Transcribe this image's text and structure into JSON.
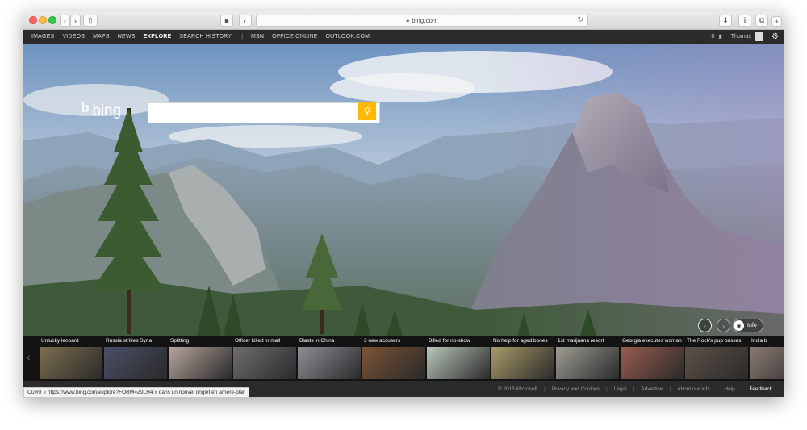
{
  "browser": {
    "url": "bing.com"
  },
  "nav": {
    "items": [
      "IMAGES",
      "VIDEOS",
      "MAPS",
      "NEWS",
      "EXPLORE",
      "SEARCH HISTORY"
    ],
    "separator": "|",
    "links": [
      "MSN",
      "OFFICE ONLINE",
      "OUTLOOK.COM"
    ],
    "rewards_count": "0",
    "user_name": "Thomas"
  },
  "logo": {
    "text": "bing"
  },
  "search": {
    "placeholder": ""
  },
  "hero_controls": {
    "info_label": "Info"
  },
  "news": [
    {
      "title": "Unlucky leopard",
      "color": "#7d6f4f"
    },
    {
      "title": "Russia strikes Syria",
      "color": "#4a4f66"
    },
    {
      "title": "Splitting",
      "color": "#b7a59d"
    },
    {
      "title": "Officer killed in mall",
      "color": "#6e6e6e"
    },
    {
      "title": "Blasts in China",
      "color": "#8c8f95"
    },
    {
      "title": "3 new accusers",
      "color": "#7c5335"
    },
    {
      "title": "Billed for no-show",
      "color": "#b9c6b9"
    },
    {
      "title": "No help for aged bones",
      "color": "#a89a6a"
    },
    {
      "title": "1st marijuana resort",
      "color": "#9e9c94"
    },
    {
      "title": "Georgia executes woman",
      "color": "#9a5c4e"
    },
    {
      "title": "The Rock's pup passes",
      "color": "#5e5149"
    },
    {
      "title": "India b",
      "color": "#8a7a74"
    }
  ],
  "footer": {
    "copyright": "© 2015 Microsoft",
    "links": [
      "Privacy and Cookies",
      "Legal",
      "Advertise",
      "About our ads",
      "Help"
    ],
    "feedback": "Feedback"
  },
  "status_bar": "Ouvrir « https://www.bing.com/explore?FORM=Z9LH4 » dans un nouvel onglet en arrière-plan"
}
